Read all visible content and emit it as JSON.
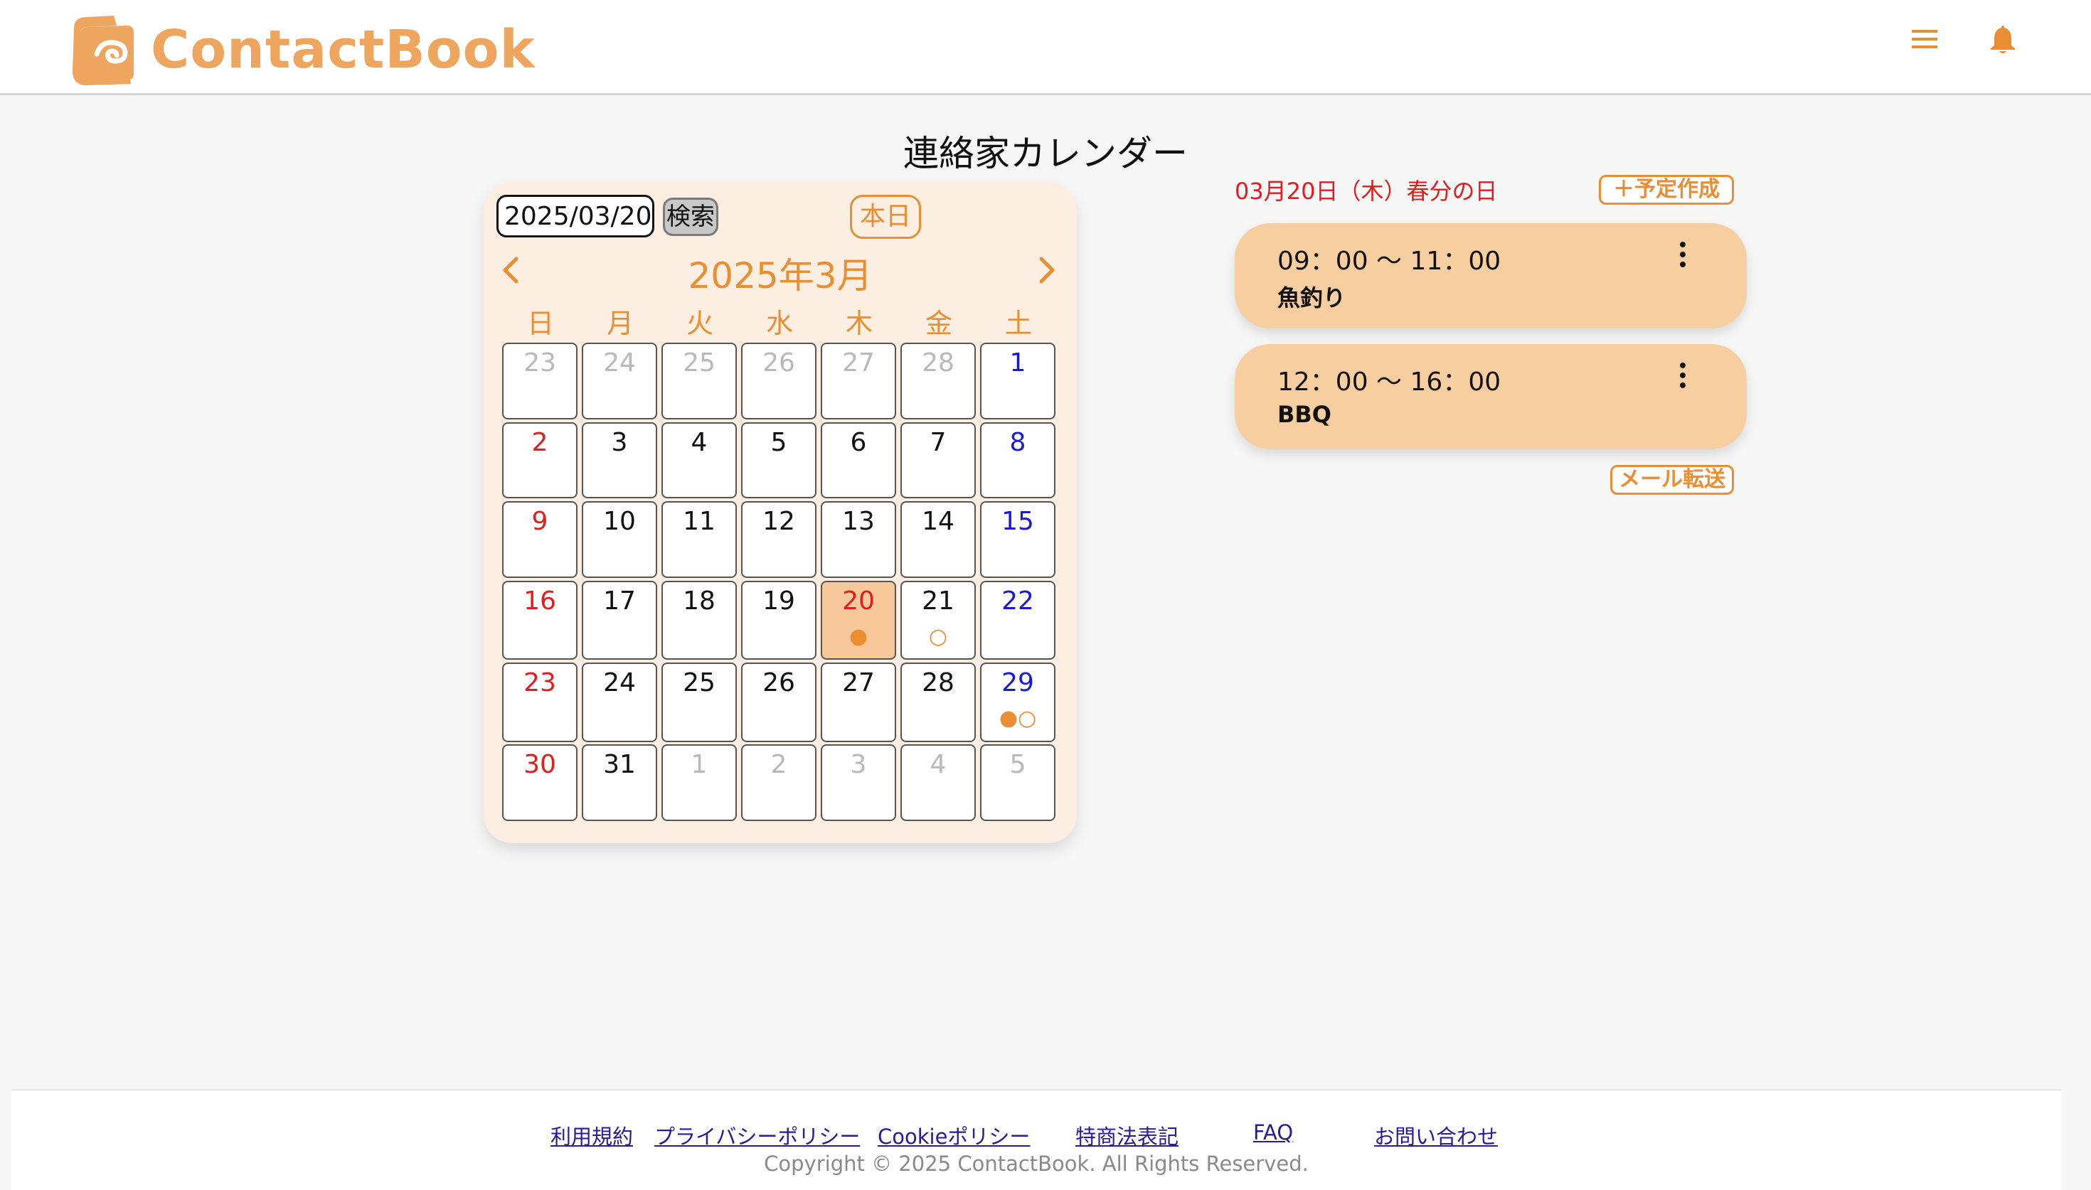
{
  "header": {
    "app_name": "ContactBook",
    "logo_icon": "book-hand-logo-icon",
    "menu_icon": "hamburger-menu-icon",
    "bell_icon": "notification-bell-icon"
  },
  "page": {
    "title": "連絡家カレンダー"
  },
  "calendar": {
    "date_input_value": "2025/03/20",
    "search_label": "検索",
    "today_label": "本日",
    "month_label": "2025年3月",
    "prev_icon": "chevron-left-icon",
    "next_icon": "chevron-right-icon",
    "weekdays": [
      "日",
      "月",
      "火",
      "水",
      "木",
      "金",
      "土"
    ],
    "weeks": [
      [
        {
          "d": "23",
          "t": "other"
        },
        {
          "d": "24",
          "t": "other"
        },
        {
          "d": "25",
          "t": "other"
        },
        {
          "d": "26",
          "t": "other"
        },
        {
          "d": "27",
          "t": "other"
        },
        {
          "d": "28",
          "t": "other"
        },
        {
          "d": "1",
          "t": "sat"
        }
      ],
      [
        {
          "d": "2",
          "t": "sun"
        },
        {
          "d": "3",
          "t": ""
        },
        {
          "d": "4",
          "t": ""
        },
        {
          "d": "5",
          "t": ""
        },
        {
          "d": "6",
          "t": ""
        },
        {
          "d": "7",
          "t": ""
        },
        {
          "d": "8",
          "t": "sat"
        }
      ],
      [
        {
          "d": "9",
          "t": "sun"
        },
        {
          "d": "10",
          "t": ""
        },
        {
          "d": "11",
          "t": ""
        },
        {
          "d": "12",
          "t": ""
        },
        {
          "d": "13",
          "t": ""
        },
        {
          "d": "14",
          "t": ""
        },
        {
          "d": "15",
          "t": "sat"
        }
      ],
      [
        {
          "d": "16",
          "t": "sun"
        },
        {
          "d": "17",
          "t": ""
        },
        {
          "d": "18",
          "t": ""
        },
        {
          "d": "19",
          "t": ""
        },
        {
          "d": "20",
          "t": "holiday selected",
          "m": "●"
        },
        {
          "d": "21",
          "t": "",
          "m": "○"
        },
        {
          "d": "22",
          "t": "sat"
        }
      ],
      [
        {
          "d": "23",
          "t": "sun"
        },
        {
          "d": "24",
          "t": ""
        },
        {
          "d": "25",
          "t": ""
        },
        {
          "d": "26",
          "t": ""
        },
        {
          "d": "27",
          "t": ""
        },
        {
          "d": "28",
          "t": ""
        },
        {
          "d": "29",
          "t": "sat",
          "m": "●○"
        }
      ],
      [
        {
          "d": "30",
          "t": "sun"
        },
        {
          "d": "31",
          "t": ""
        },
        {
          "d": "1",
          "t": "other"
        },
        {
          "d": "2",
          "t": "other"
        },
        {
          "d": "3",
          "t": "other"
        },
        {
          "d": "4",
          "t": "other"
        },
        {
          "d": "5",
          "t": "other"
        }
      ]
    ],
    "colors": {
      "accent": "#ea8d33",
      "sunday_holiday": "#e01e1e",
      "saturday": "#1a1ad6",
      "selected_bg": "#f7c99a"
    }
  },
  "schedule": {
    "selected_date": "03月20日（木）春分の日",
    "create_label": "＋予定作成",
    "events": [
      {
        "time": "09：00 〜 11：00",
        "name": "魚釣り",
        "menu_icon": "more-vertical-icon"
      },
      {
        "time": "12：00 〜 16：00",
        "name": "BBQ",
        "menu_icon": "more-vertical-icon"
      }
    ],
    "mail_label": "メール転送"
  },
  "footer": {
    "links": [
      "利用規約",
      "プライバシーポリシー",
      "Cookieポリシー",
      "特商法表記",
      "FAQ",
      "お問い合わせ"
    ],
    "copyright": "Copyright © 2025 ContactBook. All Rights Reserved."
  }
}
